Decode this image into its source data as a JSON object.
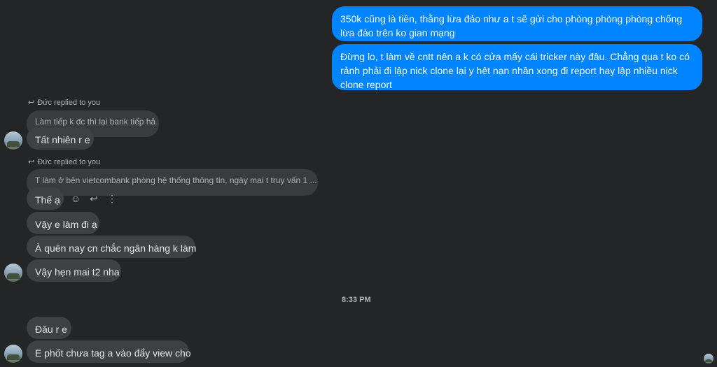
{
  "outgoing": [
    {
      "text": "350k cũng là tiền, thằng lừa đảo như a t sẽ gửi cho phòng phòng phòng chống lừa đảo trên ko gian mạng"
    },
    {
      "text": "Đừng lo, t làm về cntt nên a k có cửa mấy cái tricker này đâu. Chẳng qua t ko có rảnh phải đi lập nick clone lại y hệt nạn nhân xong đi report hay lập nhiều nick clone report"
    }
  ],
  "replies": [
    {
      "label": "Đức replied to you",
      "quoted": "Làm tiếp k đc thì lại bank tiếp hả"
    },
    {
      "label": "Đức replied to you",
      "quoted": "T làm ở bên vietcombank phòng hệ thống thông tin, ngày mai t truy vấn 1 ..."
    }
  ],
  "incoming": [
    {
      "text": "Tất nhiên r e"
    },
    {
      "text": "Thế ạ"
    },
    {
      "text": "Vậy e làm đi ạ"
    },
    {
      "text": "À quên nay cn chắc ngân hàng k làm"
    },
    {
      "text": "Vậy hẹn mai t2 nha"
    },
    {
      "text": "Đâu r e"
    },
    {
      "text": "E phốt chưa tag a vào đẩy view cho"
    }
  ],
  "timestamp": "8:33 PM",
  "icons": {
    "reply": "↩",
    "react": "☺",
    "more": "⋮"
  }
}
